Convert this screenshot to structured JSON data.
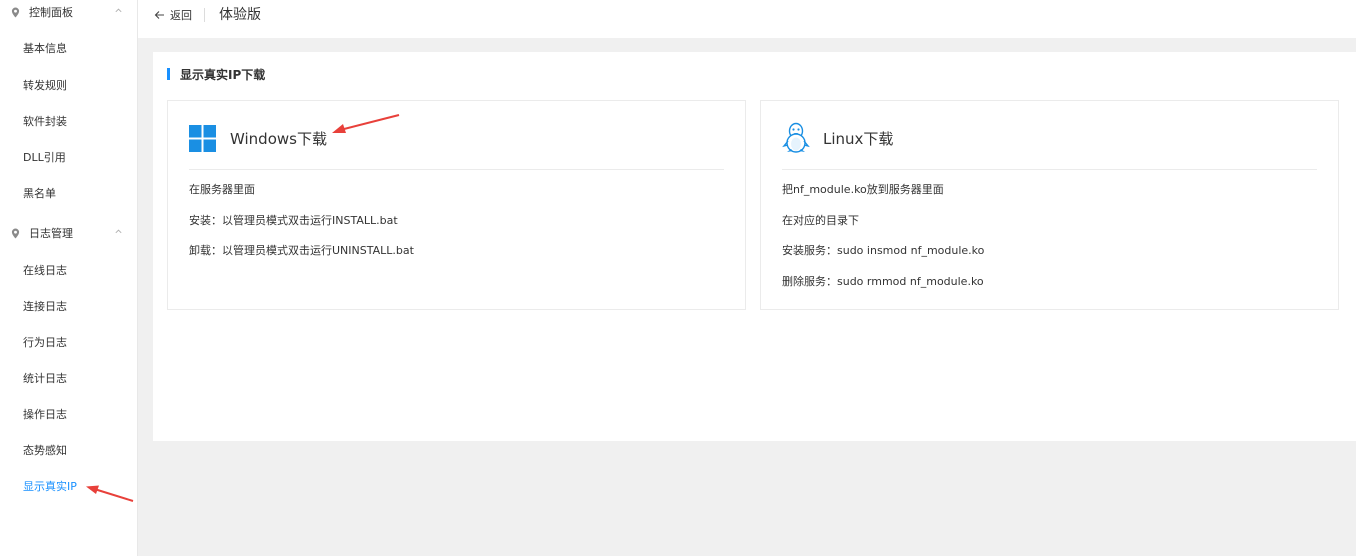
{
  "sidebar": {
    "group1": {
      "label": "控制面板"
    },
    "group1_items": [
      "基本信息",
      "转发规则",
      "软件封装",
      "DLL引用",
      "黑名单"
    ],
    "group2": {
      "label": "日志管理"
    },
    "group2_items": [
      "在线日志",
      "连接日志",
      "行为日志",
      "统计日志",
      "操作日志",
      "态势感知",
      "显示真实IP"
    ],
    "active_item": "显示真实IP"
  },
  "topbar": {
    "back_label": "返回",
    "title": "体验版"
  },
  "main": {
    "section_title": "显示真实IP下载",
    "windows": {
      "title": "Windows下载",
      "lines": [
        "在服务器里面",
        "安装：以管理员模式双击运行INSTALL.bat",
        "卸载：以管理员模式双击运行UNINSTALL.bat"
      ]
    },
    "linux": {
      "title": "Linux下载",
      "lines": [
        "把nf_module.ko放到服务器里面",
        "在对应的目录下",
        "安装服务：sudo insmod nf_module.ko",
        "删除服务：sudo rmmod nf_module.ko"
      ]
    }
  },
  "colors": {
    "accent": "#1890ff",
    "annotation_arrow": "#e8403a",
    "windows_logo": "#1a8fe3"
  },
  "icons": [
    "map-pin-icon",
    "chevron-up-icon",
    "arrow-left-icon",
    "windows-logo-icon",
    "linux-penguin-icon"
  ]
}
